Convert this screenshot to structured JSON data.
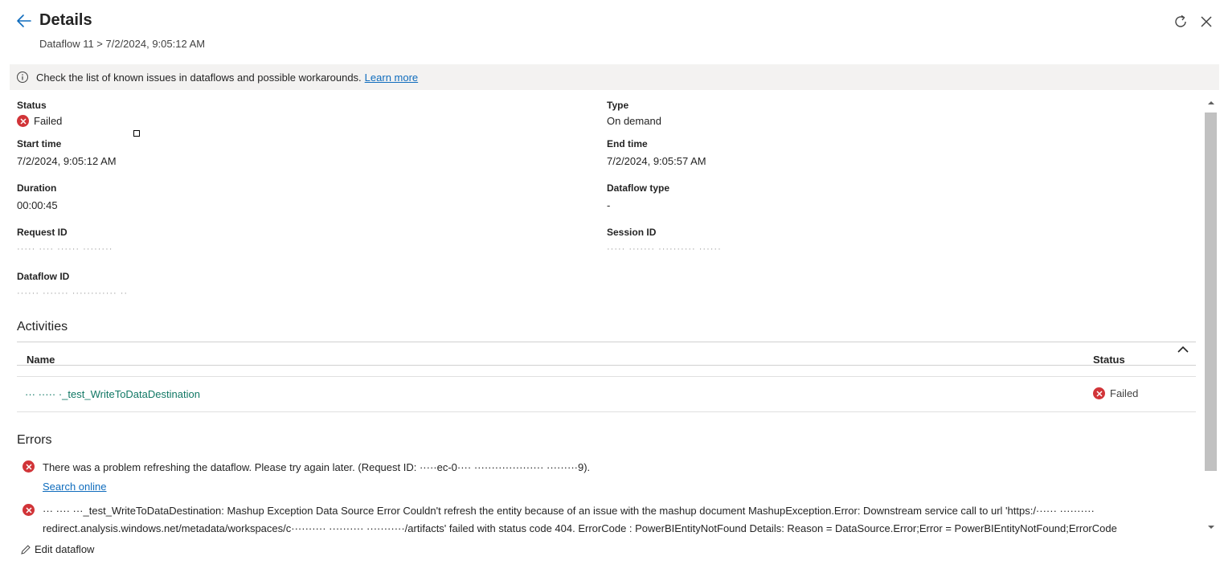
{
  "header": {
    "title": "Details",
    "breadcrumb": "Dataflow 11 > 7/2/2024, 9:05:12 AM"
  },
  "banner": {
    "text": "Check the list of known issues in dataflows and possible workarounds.",
    "link": "Learn more"
  },
  "details": {
    "status_label": "Status",
    "status_value": "Failed",
    "type_label": "Type",
    "type_value": "On demand",
    "start_label": "Start time",
    "start_value": "7/2/2024, 9:05:12 AM",
    "end_label": "End time",
    "end_value": "7/2/2024, 9:05:57 AM",
    "duration_label": "Duration",
    "duration_value": "00:00:45",
    "dataflow_type_label": "Dataflow type",
    "dataflow_type_value": "-",
    "request_id_label": "Request ID",
    "request_id_value": "····· ···· ······ ········",
    "session_id_label": "Session ID",
    "session_id_value": "····· ······· ·········· ······",
    "dataflow_id_label": "Dataflow ID",
    "dataflow_id_value": "······ ······· ············ ··"
  },
  "activities": {
    "title": "Activities",
    "col_name": "Name",
    "col_status": "Status",
    "rows": [
      {
        "name": "··· ····· ·_test_WriteToDataDestination",
        "status": "Failed"
      }
    ]
  },
  "errors": {
    "title": "Errors",
    "items": [
      {
        "text": "There was a problem refreshing the dataflow. Please try again later. (Request ID: ·····ec-0···· ···················· ·········9)."
      },
      {
        "text": "··· ···· ···_test_WriteToDataDestination: Mashup Exception Data Source Error Couldn't refresh the entity because of an issue with the mashup document MashupException.Error: Downstream service call to url 'https:/······ ·········· redirect.analysis.windows.net/metadata/workspaces/c·········· ·········· ···········/artifacts' failed with status code 404. ErrorCode : PowerBIEntityNotFound Details: Reason = DataSource.Error;Error = PowerBIEntityNotFound;ErrorCode"
      }
    ],
    "search_link": "Search online"
  },
  "footer": {
    "edit_label": "Edit dataflow"
  },
  "colors": {
    "accent": "#0f6cbd",
    "error": "#d13438",
    "link_green": "#117865"
  }
}
